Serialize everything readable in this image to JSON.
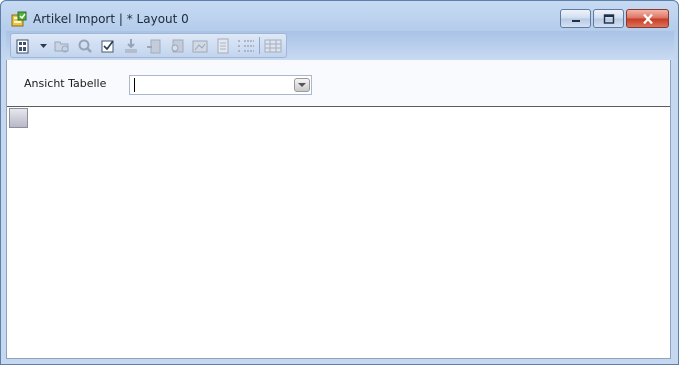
{
  "window": {
    "title": "Artikel Import | * Layout 0",
    "icon": "app-table-icon",
    "caption_buttons": [
      "minimize",
      "maximize",
      "close"
    ]
  },
  "toolbar": {
    "items": [
      {
        "name": "view-icon",
        "enabled": true
      },
      {
        "name": "dropdown-arrow-icon",
        "enabled": true
      },
      {
        "name": "open-folder-icon",
        "enabled": false
      },
      {
        "name": "search-icon",
        "enabled": false
      },
      {
        "name": "checkbox-icon",
        "enabled": true
      },
      {
        "name": "import-icon",
        "enabled": false
      },
      {
        "name": "export-icon",
        "enabled": false
      },
      {
        "name": "find-icon",
        "enabled": false
      },
      {
        "name": "image-edit-icon",
        "enabled": false
      },
      {
        "name": "document-icon",
        "enabled": false
      },
      {
        "name": "list-settings-icon",
        "enabled": false
      },
      {
        "name": "columns-icon",
        "enabled": false
      }
    ]
  },
  "filter": {
    "label": "Ansicht Tabelle",
    "combo_value": ""
  },
  "colors": {
    "titlebar": "#c7daf3",
    "toolbar": "#c2d4ee",
    "close_button": "#c63a23"
  }
}
